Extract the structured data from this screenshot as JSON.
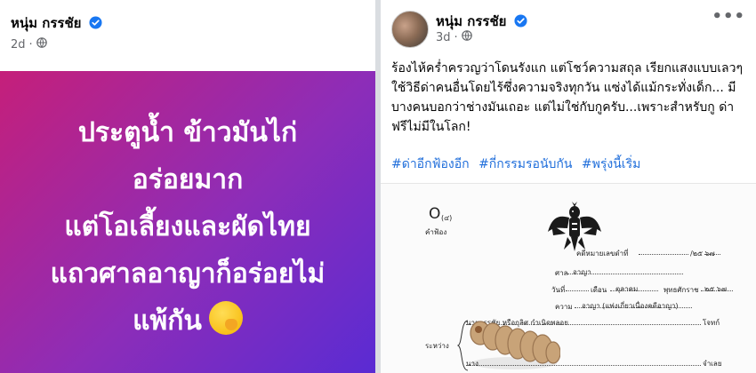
{
  "left_post": {
    "author": "หนุ่ม กรรชัย",
    "time": "2d",
    "status_lines": [
      "ประตูน้ำ ข้าวมันไก่",
      "อร่อยมาก",
      "แต่โอเลี้ยงและผัดไทย",
      "แถวศาลอาญาก็อร่อยไม่",
      "แพ้กัน"
    ],
    "background_colors": [
      "#c51f7a",
      "#8d2db8",
      "#5a2bd3"
    ]
  },
  "right_post": {
    "author": "หนุ่ม กรรชัย",
    "time": "3d",
    "body": "ร้องไห้คร่ำครวญว่าโดนรังแก แต่โชว์ความสถุล เรียกแสงแบบเลวๆ ใช้วิธีด่าคนอื่นโดยไร้ซึ่งความจริงทุกวัน แซ่งได้แม้กระทั่งเด็ก... มีบางคนบอกว่าช่างมันเถอะ แต่ไม่ใช่กับกูครับ...เพราะสำหรับกู ด่าฟรีไม่มีในโลก!",
    "hashtags": [
      "#ด่าอีกฟ้องอีก",
      "#กี่กรรมรอนับกัน",
      "#พรุ่งนี้เริ่ม"
    ],
    "document": {
      "form_mark": "O",
      "form_number": "(๔)",
      "form_title": "คำฟ้อง",
      "case_number_label": "คดีหมายเลขดำที่",
      "case_year": "/๒๕ ๖๗",
      "court_label": "ศาล",
      "court_value": "อาญา",
      "date_label": "วันที่",
      "month_label": "เดือน",
      "month_value": "ตุลาคม",
      "year_label": "พุทธศักราช",
      "year_value": "๒๕ ๖๗",
      "matter_label": "ความ",
      "matter_value": "อาญา (แพ่งเกี่ยวเนื่องคดีอาญา)",
      "plaintiff": "นายกรรชัย หรือกุลิศ กำเนิดพลอย",
      "plaintiff_role": "โจทก์",
      "between_label": "ระหว่าง",
      "defendant_prefix": "นาง",
      "defendant_role": "จำเลย"
    }
  },
  "icons": {
    "verified": "verified-badge-icon",
    "audience": "globe-icon",
    "more": "more-options-icon",
    "emoji": "face-with-hand-over-mouth-emoji",
    "seal": "garuda-emblem",
    "worm": "larva-sticker"
  },
  "colors": {
    "verified_blue": "#1877f2",
    "hashtag_blue": "#216fdb",
    "meta_gray": "#65676b"
  }
}
